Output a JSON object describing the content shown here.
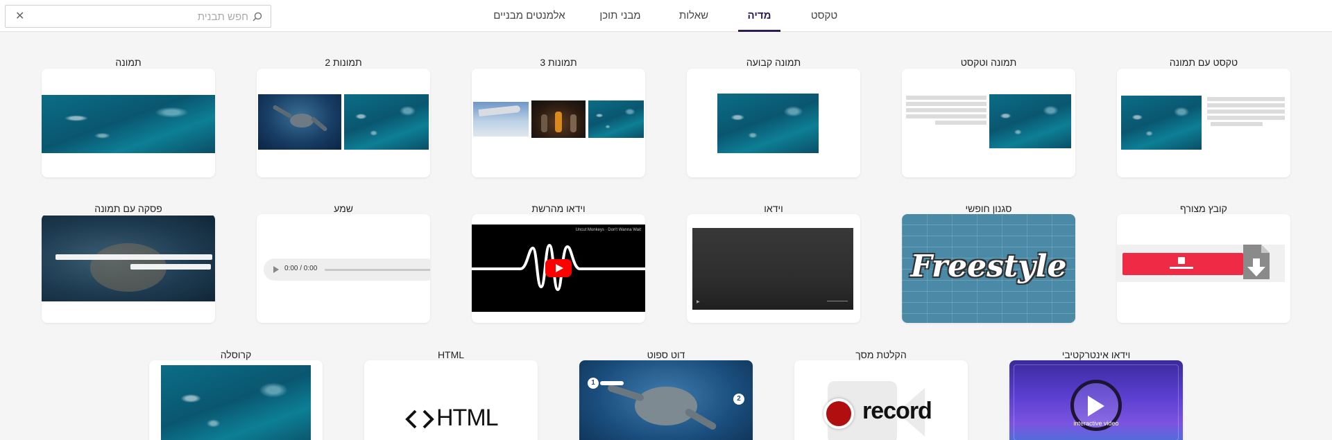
{
  "search": {
    "placeholder": "חפש תבנית",
    "value": ""
  },
  "tabs": [
    {
      "label": "טקסט",
      "active": false
    },
    {
      "label": "מדיה",
      "active": true
    },
    {
      "label": "שאלות",
      "active": false
    },
    {
      "label": "מבני תוכן",
      "active": false
    },
    {
      "label": "אלמנטים מבניים",
      "active": false
    }
  ],
  "rows": [
    {
      "items": [
        {
          "label": "טקסט עם תמונה"
        },
        {
          "label": "תמונה וטקסט"
        },
        {
          "label": "תמונה קבועה"
        },
        {
          "label": "תמונות 3"
        },
        {
          "label": "תמונות 2"
        },
        {
          "label": "תמונה"
        }
      ]
    },
    {
      "items": [
        {
          "label": "קובץ מצורף"
        },
        {
          "label": "סגנון חופשי"
        },
        {
          "label": "וידאו"
        },
        {
          "label": "וידאו מהרשת"
        },
        {
          "label": "שמע"
        },
        {
          "label": "פסקה עם תמונה"
        }
      ]
    },
    {
      "items": [
        {
          "label": "וידאו אינטרקטיבי"
        },
        {
          "label": "הקלטת מסך"
        },
        {
          "label": "דוט ספוט"
        },
        {
          "label": "HTML"
        },
        {
          "label": "קרוסלה"
        }
      ]
    }
  ],
  "thumbs": {
    "audio_time": "0:00 / 0:00",
    "freestyle_text": "Freestyle",
    "record_text": "record",
    "html_text": "HTML",
    "interactive_text": "interactive video",
    "youtube_caption": "Uncut Monkeys · Don't Wanna Wait",
    "hotspot_1": "1",
    "hotspot_2": "2"
  },
  "colors": {
    "accent": "#2d1b52",
    "attachment_red": "#ee2a45",
    "record_red": "#b10f0f",
    "freestyle_bg": "#4a8aa6"
  }
}
